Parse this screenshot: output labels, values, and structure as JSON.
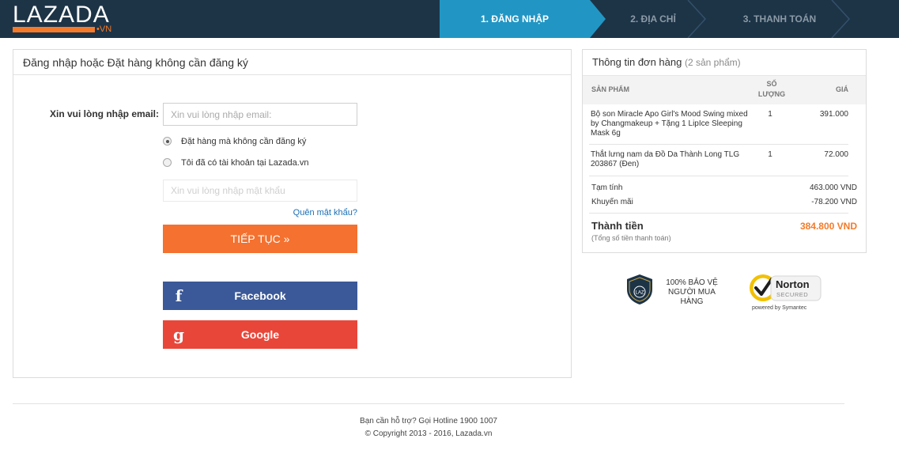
{
  "header": {
    "logo_text": "LAZADA",
    "logo_suffix": "•VN",
    "steps": [
      "1. ĐĂNG NHẬP",
      "2. ĐỊA CHỈ",
      "3. THANH TOÁN"
    ]
  },
  "login": {
    "title": "Đăng nhập hoặc Đặt hàng không cần đăng ký",
    "email_label": "Xin vui lòng nhập email:",
    "email_placeholder": "Xin vui lòng nhập email:",
    "option_guest": "Đặt hàng mà không cần đăng ký",
    "option_account": "Tôi đã có tài khoản tại Lazada.vn",
    "password_placeholder": "Xin vui lòng nhập mật khẩu",
    "forgot_label": "Quên mật khẩu?",
    "continue_label": "TIẾP TỤC »",
    "facebook_label": "Facebook",
    "google_label": "Google"
  },
  "order": {
    "title": "Thông tin đơn hàng",
    "count": "(2 sản phẩm)",
    "col_product": "SẢN PHẨM",
    "col_qty": "SỐ LƯỢNG",
    "col_price": "GIÁ",
    "items": [
      {
        "name": "Bộ son Miracle Apo Girl's Mood Swing mixed by Changmakeup + Tặng 1 LipIce Sleeping Mask 6g",
        "qty": "1",
        "price": "391.000"
      },
      {
        "name": "Thắt lưng nam da Đồ Da Thành Long TLG 203867 (Đen)",
        "qty": "1",
        "price": "72.000"
      }
    ],
    "subtotal_label": "Tạm tính",
    "subtotal_value": "463.000 VND",
    "discount_label": "Khuyến mãi",
    "discount_value": "-78.200 VND",
    "total_label": "Thành tiền",
    "total_value": "384.800 VND",
    "total_note": "(Tổng số tiền thanh toán)"
  },
  "badges": {
    "protection_text": "100% BẢO VỆ NGƯỜI MUA HÀNG",
    "shield_text": "LAZ",
    "norton_name": "Norton",
    "norton_secured": "SECURED",
    "norton_powered": "powered by Symantec"
  },
  "footer": {
    "hotline": "Bạn cần hỗ trợ? Gọi Hotline 1900 1007",
    "copyright": "© Copyright 2013 - 2016, Lazada.vn"
  },
  "colors": {
    "header_bg": "#1d3447",
    "active_step": "#2196c4",
    "accent": "#f47a2a",
    "facebook": "#3b5998",
    "google": "#e9463a",
    "link": "#1a6fb5"
  }
}
